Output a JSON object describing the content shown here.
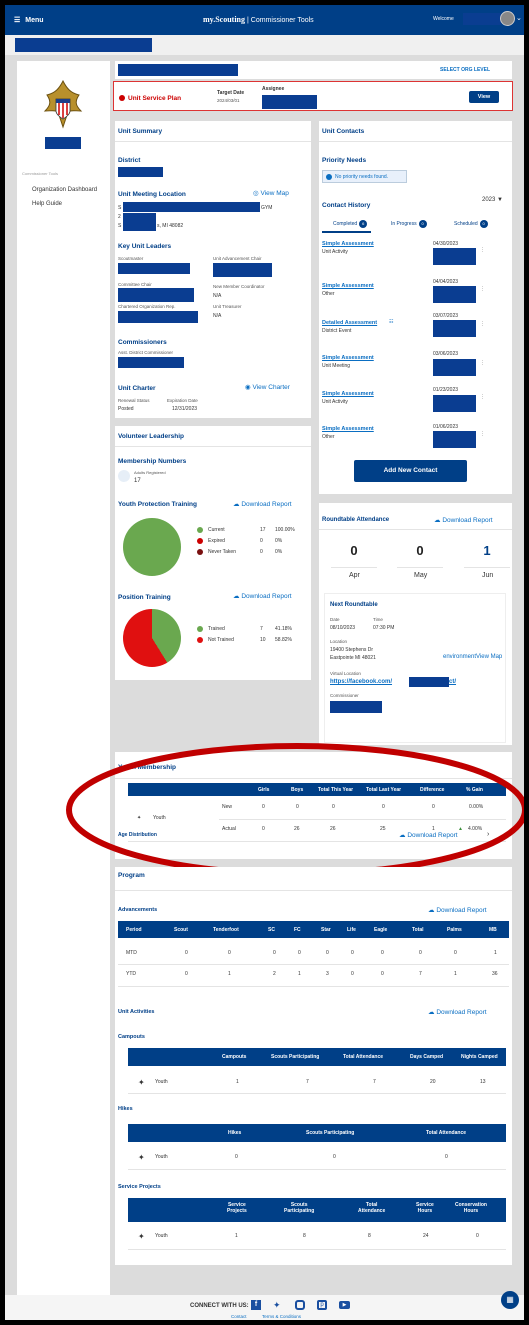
{
  "header": {
    "menu_label": "Menu",
    "brand": "my.Scouting",
    "brand_sub": "| Commissioner Tools",
    "welcome": "Welcome"
  },
  "sidebar": {
    "section_label": "Commissioner Tools",
    "items": [
      {
        "label": "Organization Dashboard"
      },
      {
        "label": "Help Guide"
      }
    ]
  },
  "org": {
    "select_level": "SELECT ORG LEVEL"
  },
  "usp": {
    "title": "Unit Service Plan",
    "target_label": "Target Date",
    "target_value": "2024/03/01",
    "assignee_label": "Assignee",
    "view": "View"
  },
  "summary": {
    "title": "Unit Summary",
    "district": "District",
    "meeting_location": "Unit Meeting Location",
    "view_map": "View Map",
    "loc_line1_prefix": "S",
    "loc_line1_suffix": "GYM",
    "loc_line2": "2",
    "loc_line3_prefix": "S",
    "loc_line3_suffix": "s, MI 48082",
    "key_leaders": "Key Unit Leaders",
    "scoutmaster": "Scoutmaster",
    "adv_chair": "Unit Advancement Chair",
    "committee_chair": "Committee Chair",
    "new_member": "New Member Coordinator",
    "new_member_val": "N/A",
    "co_rep": "Chartered Organization Rep.",
    "treasurer": "Unit Treasurer",
    "treasurer_val": "N/A",
    "commissioners": "Commissioners",
    "adc": "Asst. District Commissioner",
    "charter": "Unit Charter",
    "view_charter": "View Charter",
    "renewal_label": "Renewal Status",
    "renewal_val": "Posted",
    "exp_label": "Expiration Date",
    "exp_val": "12/31/2023"
  },
  "contacts": {
    "title": "Unit Contacts",
    "priority": "Priority Needs",
    "priority_none": "No priority needs found.",
    "history": "Contact History",
    "year": "2023",
    "tabs": [
      {
        "label": "Completed",
        "count": "6"
      },
      {
        "label": "In Progress",
        "count": "0"
      },
      {
        "label": "Scheduled",
        "count": "0"
      }
    ],
    "entries": [
      {
        "type": "Simple Assessment",
        "sub": "Unit Activity",
        "date": "04/30/2023"
      },
      {
        "type": "Simple Assessment",
        "sub": "Other",
        "date": "04/04/2023"
      },
      {
        "type": "Detailed Assessment",
        "sub": "District Event",
        "date": "03/07/2023"
      },
      {
        "type": "Simple Assessment",
        "sub": "Unit Meeting",
        "date": "03/06/2023"
      },
      {
        "type": "Simple Assessment",
        "sub": "Unit Activity",
        "date": "01/23/2023"
      },
      {
        "type": "Simple Assessment",
        "sub": "Other",
        "date": "01/06/2023"
      }
    ],
    "add": "Add New Contact"
  },
  "volunteer": {
    "title": "Volunteer Leadership",
    "membership": "Membership Numbers",
    "adults_label": "Adults Registered",
    "adults_val": "17",
    "ypt": "Youth Protection Training",
    "download": "Download Report",
    "ypt_rows": [
      {
        "label": "Current",
        "n": "17",
        "p": "100.00%",
        "color": "#6aa84f"
      },
      {
        "label": "Expired",
        "n": "0",
        "p": "0%",
        "color": "#cc0000"
      },
      {
        "label": "Never Taken",
        "n": "0",
        "p": "0%",
        "color": "#7a1010"
      }
    ],
    "pos": "Position Training",
    "pos_rows": [
      {
        "label": "Trained",
        "n": "7",
        "p": "41.18%",
        "color": "#6aa84f"
      },
      {
        "label": "Not Trained",
        "n": "10",
        "p": "58.82%",
        "color": "#e01010"
      }
    ]
  },
  "roundtable": {
    "title": "Roundtable Attendance",
    "download": "Download Report",
    "months": [
      {
        "n": "0",
        "m": "Apr"
      },
      {
        "n": "0",
        "m": "May"
      },
      {
        "n": "1",
        "m": "Jun"
      }
    ],
    "next": "Next Roundtable",
    "date_label": "Date",
    "date_val": "08/10/2023",
    "time_label": "Time",
    "time_val": "07:30 PM",
    "location_label": "Location",
    "loc1": "19400 Stephens Dr",
    "loc2": "Eastpointe MI 48021",
    "env": "environmentView Map",
    "virtual_label": "Virtual Location",
    "virtual_link": "https://facebook.com/",
    "virtual_tail": "ct/",
    "commissioner": "Commissioner"
  },
  "youth": {
    "title": "Youth Membership",
    "headers": [
      "Girls",
      "Boys",
      "Total This Year",
      "Total Last Year",
      "Difference",
      "% Gain"
    ],
    "label": "Youth",
    "rows": [
      {
        "name": "New",
        "vals": [
          "0",
          "0",
          "0",
          "0",
          "0",
          "0.00%"
        ]
      },
      {
        "name": "Actual",
        "vals": [
          "0",
          "26",
          "26",
          "25",
          "1",
          "4.00%"
        ]
      }
    ],
    "age": "Age Distribution",
    "download": "Download Report"
  },
  "program": {
    "title": "Program",
    "advancements": "Advancements",
    "download": "Download Report",
    "adv_headers": [
      "Period",
      "Scout",
      "Tenderfoot",
      "SC",
      "FC",
      "Star",
      "Life",
      "Eagle",
      "Total",
      "Palms",
      "MB"
    ],
    "adv_rows": [
      [
        "MTD",
        "0",
        "0",
        "0",
        "0",
        "0",
        "0",
        "0",
        "0",
        "0",
        "1"
      ],
      [
        "YTD",
        "0",
        "1",
        "2",
        "1",
        "3",
        "0",
        "0",
        "7",
        "1",
        "36"
      ]
    ],
    "activities": "Unit Activities",
    "campouts": "Campouts",
    "camp_headers": [
      "Campouts",
      "Scouts Participating",
      "Total Attendance",
      "Days Camped",
      "Nights Camped"
    ],
    "camp_vals": [
      "1",
      "7",
      "7",
      "20",
      "13"
    ],
    "hikes": "Hikes",
    "hike_headers": [
      "Hikes",
      "Scouts Participating",
      "Total Attendance"
    ],
    "hike_vals": [
      "0",
      "0",
      "0"
    ],
    "service": "Service Projects",
    "svc_headers": [
      "Service\nProjects",
      "Scouts\nParticipating",
      "Total\nAttendance",
      "Service\nHours",
      "Conservation\nHours"
    ],
    "svc_vals": [
      "1",
      "8",
      "8",
      "24",
      "0"
    ],
    "youth": "Youth"
  },
  "footer": {
    "connect": "CONNECT WITH US:",
    "contact": "Contact",
    "terms": "Terms & Conditions"
  }
}
